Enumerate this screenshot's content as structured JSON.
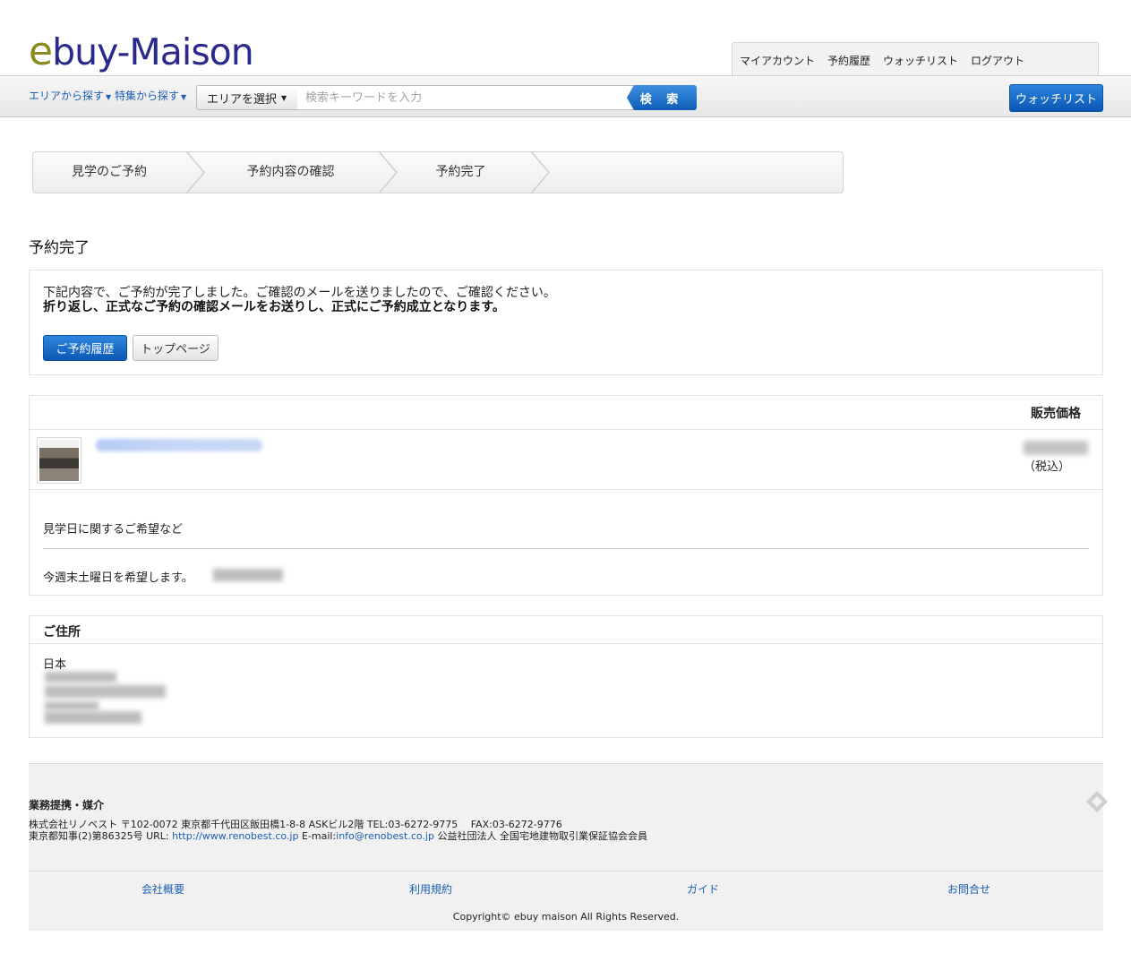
{
  "logo": {
    "first": "e",
    "rest": "buy-Maison"
  },
  "topnav": {
    "items": [
      "マイアカウント",
      "予約履歴",
      "ウォッチリスト",
      "ログアウト"
    ]
  },
  "search": {
    "area_nav": "エリアから探す",
    "feature_nav": "特集から探す",
    "area_select": "エリアを選択",
    "placeholder": "検索キーワードを入力",
    "button": "検 索",
    "watchlist": "ウォッチリスト"
  },
  "steps": [
    "見学のご予約",
    "予約内容の確認",
    "予約完了"
  ],
  "page_title": "予約完了",
  "completion": {
    "message1": "下記内容で、ご予約が完了しました。ご確認のメールを送りましたので、ご確認ください。",
    "message2": "折り返し、正式なご予約の確認メールをお送りし、正式にご予約成立となります。",
    "history_button": "ご予約履歴",
    "top_button": "トップページ"
  },
  "reservation": {
    "price_header": "販売価格",
    "tax_note": "（税込）",
    "hope_label": "見学日に関するご希望など",
    "hope_text": "今週末土曜日を希望します。"
  },
  "address": {
    "header": "ご住所",
    "country": "日本"
  },
  "footer": {
    "heading": "業務提携・媒介",
    "line1": "株式会社リノベスト 〒102-0072 東京都千代田区飯田橋1-8-8 ASKビル2階 TEL:03-6272-9775　 FAX:03-6272-9776",
    "line2_prefix": "東京都知事(2)第86325号 URL: ",
    "url": "http://www.renobest.co.jp",
    "email_prefix": " E-mail:",
    "email": "info@renobest.co.jp",
    "line2_suffix": " 公益社団法人 全国宅地建物取引業保証協会会員",
    "links": [
      "会社概要",
      "利用規約",
      "ガイド",
      "お問合せ"
    ],
    "copyright": "Copyright© ebuy maison All Rights Reserved."
  }
}
